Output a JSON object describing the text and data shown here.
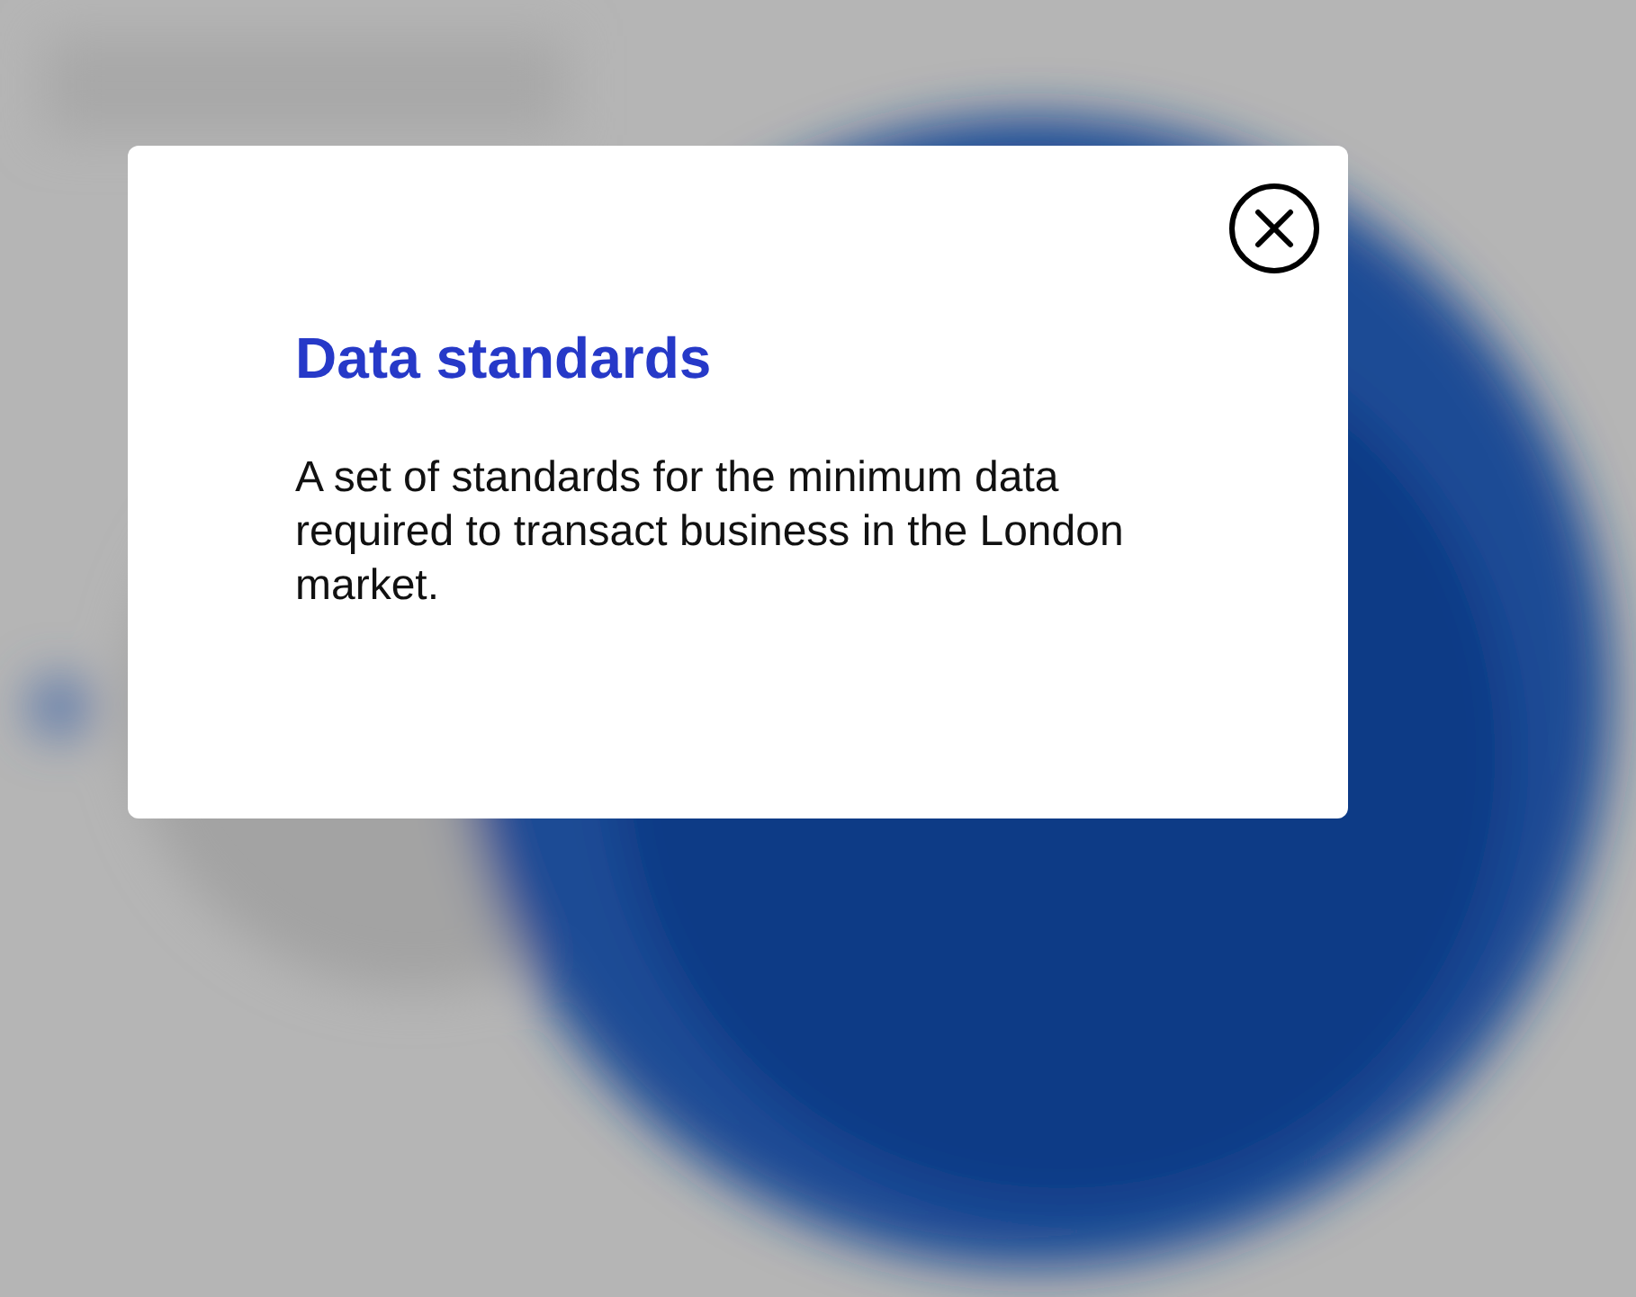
{
  "dialog": {
    "title": "Data standards",
    "text": "A set of standards for the minimum data required to transact business in the London market."
  }
}
